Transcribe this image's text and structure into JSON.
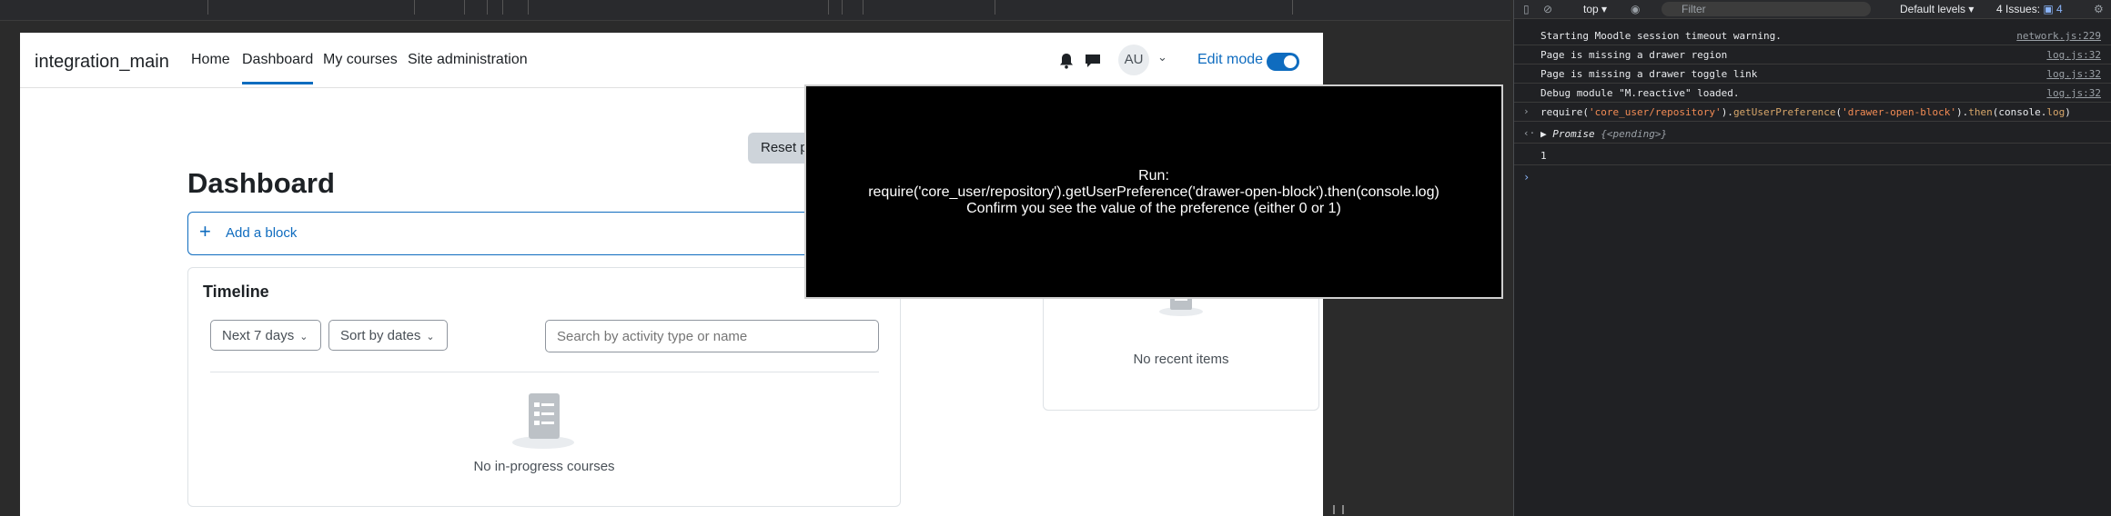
{
  "navbar": {
    "brand": "integration_main",
    "links": [
      {
        "label": "Home"
      },
      {
        "label": "Dashboard"
      },
      {
        "label": "My courses"
      },
      {
        "label": "Site administration"
      }
    ],
    "avatar": "AU",
    "edit_mode": "Edit mode"
  },
  "main": {
    "reset_button": "Reset p",
    "title": "Dashboard",
    "add_block": "Add a block"
  },
  "timeline": {
    "title": "Timeline",
    "filter_days": "Next 7 days",
    "sort": "Sort by dates",
    "search_placeholder": "Search by activity type or name",
    "empty": "No in-progress courses"
  },
  "recent": {
    "empty": "No recent items"
  },
  "overlay": {
    "line1": "Run:",
    "line2": "require('core_user/repository').getUserPreference('drawer-open-block').then(console.log)",
    "line3": "Confirm you see the value of the preference (either 0 or 1)"
  },
  "devtools": {
    "context": "top",
    "filter_placeholder": "Filter",
    "levels": "Default levels",
    "issues_label": "4 Issues:",
    "issues_count": "4",
    "logs": [
      {
        "msg": "Starting Moodle session timeout warning.",
        "src": "network.js:229"
      },
      {
        "msg": "Page is missing a drawer region",
        "src": "log.js:32"
      },
      {
        "msg": "Page is missing a drawer toggle link",
        "src": "log.js:32"
      },
      {
        "msg": "Debug module \"M.reactive\" loaded.",
        "src": "log.js:32"
      }
    ],
    "command": {
      "p1": "require(",
      "s1": "'core_user/repository'",
      "p2": ").",
      "m1": "getUserPreference",
      "p3": "(",
      "s2": "'drawer-open-block'",
      "p4": ").",
      "m2": "then",
      "p5": "(console.",
      "m3": "log",
      "p6": ")"
    },
    "promise_label": "Promise",
    "promise_state": "{<pending>}",
    "result": "1"
  },
  "colors": {
    "accent": "#0f6cbf",
    "devtools_bg": "#202124"
  }
}
